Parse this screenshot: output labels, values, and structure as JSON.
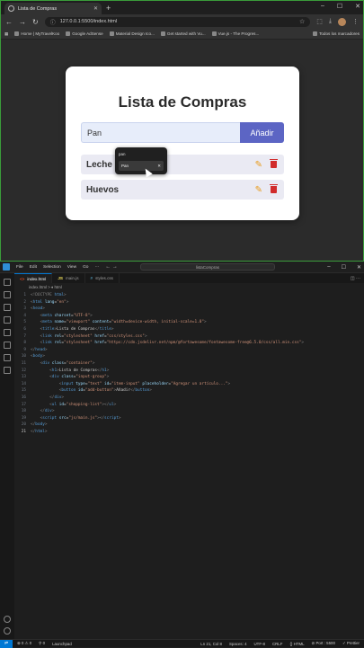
{
  "browser": {
    "tab_title": "Lista de Compras",
    "tab_close": "✕",
    "new_tab": "+",
    "window_controls": [
      "–",
      "☐",
      "✕"
    ],
    "nav": {
      "back": "←",
      "forward": "→",
      "reload": "↻"
    },
    "url": "127.0.0.1:5500/index.html",
    "bookmarks": [
      "Home | MyTravelKoo",
      "Google AdSense",
      "Material Design Ico...",
      "Get started with Vu...",
      "Vue.js - The Progres..."
    ],
    "bookmarks_right": "Todos los marcadores"
  },
  "app": {
    "title": "Lista de Compras",
    "input_value": "Pan",
    "add_button": "Añadir",
    "items": [
      {
        "name": "Leche"
      },
      {
        "name": "Huevos"
      }
    ],
    "autocomplete": {
      "header": "pan",
      "suggestion": "Pan",
      "close": "✕"
    }
  },
  "vscode": {
    "menu": [
      "File",
      "Edit",
      "Selection",
      "View",
      "Go",
      "···"
    ],
    "search": "listaCompras",
    "window_controls": [
      "–",
      "☐",
      "✕"
    ],
    "tabs": [
      {
        "label": "index.html",
        "icon": "<>",
        "active": true,
        "color": "#e44d26"
      },
      {
        "label": "main.js",
        "icon": "JS",
        "active": false,
        "color": "#f1e05a"
      },
      {
        "label": "styles.css",
        "icon": "#",
        "active": false,
        "color": "#519aba"
      }
    ],
    "breadcrumbs": "index.html > ♦ html",
    "lines": [
      [
        [
          "<!DOCTYPE ",
          "#808080"
        ],
        [
          "html",
          "#569cd6"
        ],
        [
          ">",
          "#808080"
        ]
      ],
      [
        [
          "<",
          "#808080"
        ],
        [
          "html ",
          "#569cd6"
        ],
        [
          "lang",
          "#9cdcfe"
        ],
        [
          "=",
          "#ccc"
        ],
        [
          "\"en\"",
          "#ce9178"
        ],
        [
          ">",
          "#808080"
        ]
      ],
      [
        [
          "<",
          "#808080"
        ],
        [
          "head",
          "#569cd6"
        ],
        [
          ">",
          "#808080"
        ]
      ],
      [
        [
          "    <",
          "#808080"
        ],
        [
          "meta ",
          "#569cd6"
        ],
        [
          "charset",
          "#9cdcfe"
        ],
        [
          "=",
          "#ccc"
        ],
        [
          "\"UTF-8\"",
          "#ce9178"
        ],
        [
          ">",
          "#808080"
        ]
      ],
      [
        [
          "    <",
          "#808080"
        ],
        [
          "meta ",
          "#569cd6"
        ],
        [
          "name",
          "#9cdcfe"
        ],
        [
          "=",
          "#ccc"
        ],
        [
          "\"viewport\" ",
          "#ce9178"
        ],
        [
          "content",
          "#9cdcfe"
        ],
        [
          "=",
          "#ccc"
        ],
        [
          "\"width=device-width, initial-scale=1.0\"",
          "#ce9178"
        ],
        [
          ">",
          "#808080"
        ]
      ],
      [
        [
          "    <",
          "#808080"
        ],
        [
          "title",
          "#569cd6"
        ],
        [
          ">",
          "#808080"
        ],
        [
          "Lista de Compras",
          "#ccc"
        ],
        [
          "</",
          "#808080"
        ],
        [
          "title",
          "#569cd6"
        ],
        [
          ">",
          "#808080"
        ]
      ],
      [
        [
          "    <",
          "#808080"
        ],
        [
          "link ",
          "#569cd6"
        ],
        [
          "rel",
          "#9cdcfe"
        ],
        [
          "=",
          "#ccc"
        ],
        [
          "\"stylesheet\" ",
          "#ce9178"
        ],
        [
          "href",
          "#9cdcfe"
        ],
        [
          "=",
          "#ccc"
        ],
        [
          "\"css/styles.css\"",
          "#ce9178"
        ],
        [
          ">",
          "#808080"
        ]
      ],
      [
        [
          "    <",
          "#808080"
        ],
        [
          "link ",
          "#569cd6"
        ],
        [
          "rel",
          "#9cdcfe"
        ],
        [
          "=",
          "#ccc"
        ],
        [
          "\"stylesheet\" ",
          "#ce9178"
        ],
        [
          "href",
          "#9cdcfe"
        ],
        [
          "=",
          "#ccc"
        ],
        [
          "\"https://cdn.jsdelivr.net/npm/@fortawesome/fontawesome-free@6.5.0/css/all.min.css\"",
          "#ce9178"
        ],
        [
          ">",
          "#808080"
        ]
      ],
      [
        [
          "</",
          "#808080"
        ],
        [
          "head",
          "#569cd6"
        ],
        [
          ">",
          "#808080"
        ]
      ],
      [
        [
          "<",
          "#808080"
        ],
        [
          "body",
          "#569cd6"
        ],
        [
          ">",
          "#808080"
        ]
      ],
      [
        [
          "    <",
          "#808080"
        ],
        [
          "div ",
          "#569cd6"
        ],
        [
          "class",
          "#9cdcfe"
        ],
        [
          "=",
          "#ccc"
        ],
        [
          "\"container\"",
          "#ce9178"
        ],
        [
          ">",
          "#808080"
        ]
      ],
      [
        [
          "        <",
          "#808080"
        ],
        [
          "h1",
          "#569cd6"
        ],
        [
          ">",
          "#808080"
        ],
        [
          "Lista de Compras",
          "#ccc"
        ],
        [
          "</",
          "#808080"
        ],
        [
          "h1",
          "#569cd6"
        ],
        [
          ">",
          "#808080"
        ]
      ],
      [
        [
          "        <",
          "#808080"
        ],
        [
          "div ",
          "#569cd6"
        ],
        [
          "class",
          "#9cdcfe"
        ],
        [
          "=",
          "#ccc"
        ],
        [
          "\"input-group\"",
          "#ce9178"
        ],
        [
          ">",
          "#808080"
        ]
      ],
      [
        [
          "            <",
          "#808080"
        ],
        [
          "input ",
          "#569cd6"
        ],
        [
          "type",
          "#9cdcfe"
        ],
        [
          "=",
          "#ccc"
        ],
        [
          "\"text\" ",
          "#ce9178"
        ],
        [
          "id",
          "#9cdcfe"
        ],
        [
          "=",
          "#ccc"
        ],
        [
          "\"item-input\" ",
          "#ce9178"
        ],
        [
          "placeholder",
          "#9cdcfe"
        ],
        [
          "=",
          "#ccc"
        ],
        [
          "\"Agregar un artículo...\"",
          "#ce9178"
        ],
        [
          ">",
          "#808080"
        ]
      ],
      [
        [
          "            <",
          "#808080"
        ],
        [
          "button ",
          "#569cd6"
        ],
        [
          "id",
          "#9cdcfe"
        ],
        [
          "=",
          "#ccc"
        ],
        [
          "\"add-button\"",
          "#ce9178"
        ],
        [
          ">",
          "#808080"
        ],
        [
          "Añadir",
          "#ccc"
        ],
        [
          "</",
          "#808080"
        ],
        [
          "button",
          "#569cd6"
        ],
        [
          ">",
          "#808080"
        ]
      ],
      [
        [
          "        </",
          "#808080"
        ],
        [
          "div",
          "#569cd6"
        ],
        [
          ">",
          "#808080"
        ]
      ],
      [
        [
          "        <",
          "#808080"
        ],
        [
          "ul ",
          "#569cd6"
        ],
        [
          "id",
          "#9cdcfe"
        ],
        [
          "=",
          "#ccc"
        ],
        [
          "\"shopping-list\"",
          "#ce9178"
        ],
        [
          ">",
          "#808080"
        ],
        [
          "</",
          "#808080"
        ],
        [
          "ul",
          "#569cd6"
        ],
        [
          ">",
          "#808080"
        ]
      ],
      [
        [
          "    </",
          "#808080"
        ],
        [
          "div",
          "#569cd6"
        ],
        [
          ">",
          "#808080"
        ]
      ],
      [
        [
          "    <",
          "#808080"
        ],
        [
          "script ",
          "#569cd6"
        ],
        [
          "src",
          "#9cdcfe"
        ],
        [
          "=",
          "#ccc"
        ],
        [
          "\"js/main.js\"",
          "#ce9178"
        ],
        [
          ">",
          "#808080"
        ],
        [
          "</",
          "#808080"
        ],
        [
          "script",
          "#569cd6"
        ],
        [
          ">",
          "#808080"
        ]
      ],
      [
        [
          "</",
          "#808080"
        ],
        [
          "body",
          "#569cd6"
        ],
        [
          ">",
          "#808080"
        ]
      ],
      [
        [
          "</",
          "#808080"
        ],
        [
          "html",
          "#569cd6"
        ],
        [
          ">",
          "#808080"
        ]
      ]
    ],
    "current_line": 21,
    "status_left": [
      "⊗ 0 ⚠ 0",
      "⚲ 0",
      "Launchpad"
    ],
    "status_right": [
      "Ln 21, Col 8",
      "Spaces: 4",
      "UTF-8",
      "CRLF",
      "{} HTML",
      "⊘ Port : 5500",
      "✓ Prettier"
    ]
  },
  "icons": {
    "edit": "pencil-icon",
    "delete": "trash-icon",
    "accent": "#5c65c4",
    "edit_color": "#e89b1b",
    "delete_color": "#d12b2b"
  }
}
